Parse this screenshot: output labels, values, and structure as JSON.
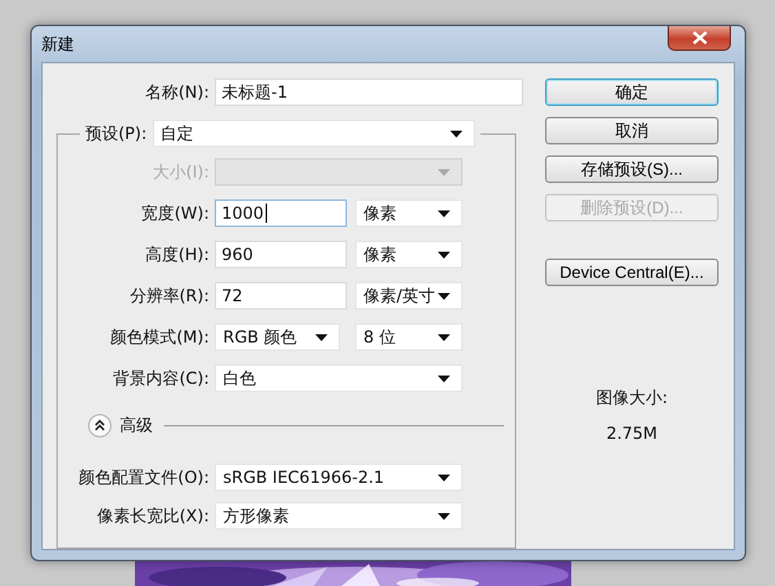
{
  "window": {
    "title": "新建"
  },
  "name": {
    "label": "名称(N):",
    "value": "未标题-1"
  },
  "preset": {
    "label": "预设(P):",
    "value": "自定"
  },
  "rows": [
    {
      "kind": "combo",
      "label": "大小(I):",
      "disabled": true
    },
    {
      "kind": "number_unit",
      "label": "宽度(W):",
      "value": "1000",
      "focused": true,
      "unit": "像素"
    },
    {
      "kind": "number_unit",
      "label": "高度(H):",
      "value": "960",
      "focused": false,
      "unit": "像素"
    },
    {
      "kind": "number_unit",
      "label": "分辨率(R):",
      "value": "72",
      "focused": false,
      "unit": "像素/英寸"
    },
    {
      "kind": "two_combos",
      "label": "颜色模式(M):",
      "value": "RGB 颜色",
      "unit": "8 位"
    },
    {
      "kind": "combo",
      "label": "背景内容(C):",
      "value": "白色",
      "disabled": false
    }
  ],
  "advanced": {
    "label": "高级",
    "expanded": true,
    "rows": [
      {
        "label": "颜色配置文件(O):",
        "value": "sRGB IEC61966-2.1"
      },
      {
        "label": "像素长宽比(X):",
        "value": "方形像素"
      }
    ]
  },
  "buttons": [
    {
      "label": "确定",
      "default": true,
      "disabled": false
    },
    {
      "label": "取消",
      "default": false,
      "disabled": false
    },
    {
      "label": "存储预设(S)...",
      "default": false,
      "disabled": false
    },
    {
      "label": "删除预设(D)...",
      "default": false,
      "disabled": true
    }
  ],
  "extra_buttons": [
    {
      "label": "Device Central(E)...",
      "default": false,
      "disabled": false
    }
  ],
  "image_size": {
    "label": "图像大小:",
    "value": "2.75M"
  }
}
